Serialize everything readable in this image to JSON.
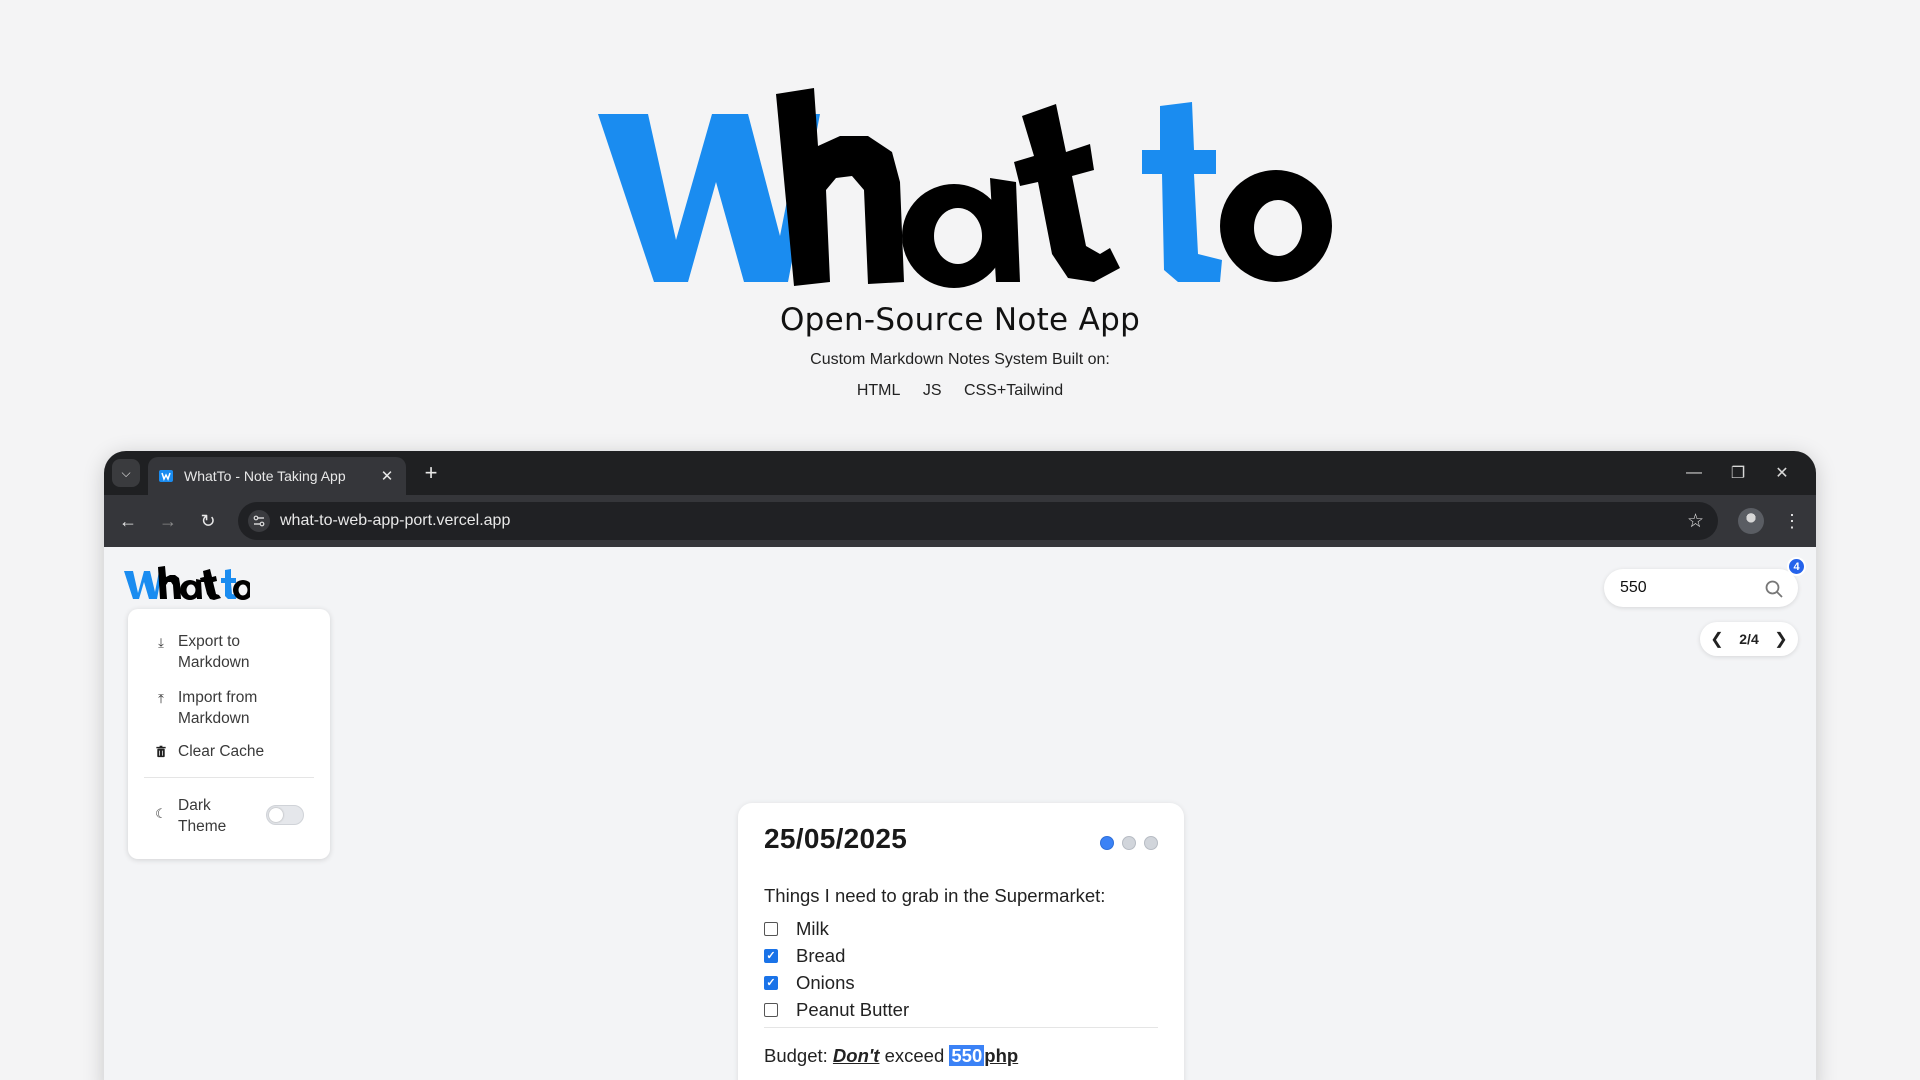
{
  "hero": {
    "logo_text": "What to",
    "subtitle": "Open-Source Note App",
    "description": "Custom Markdown Notes System Built on:",
    "tech": [
      "HTML",
      "JS",
      "CSS+Tailwind"
    ]
  },
  "browser": {
    "tab_title": "WhatTo - Note Taking App",
    "url": "what-to-web-app-port.vercel.app"
  },
  "sidebar_menu": {
    "export_label": "Export to Markdown",
    "import_label": "Import from Markdown",
    "clear_label": "Clear Cache",
    "dark_theme_label": "Dark Theme",
    "dark_theme_on": false
  },
  "search": {
    "value": "550",
    "match_count": "4",
    "pager": "2/4"
  },
  "note": {
    "date": "25/05/2025",
    "heading": "Things I need to grab in the Supermarket:",
    "items": [
      {
        "label": "Milk",
        "checked": false
      },
      {
        "label": "Bread",
        "checked": true
      },
      {
        "label": "Onions",
        "checked": true
      },
      {
        "label": "Peanut Butter",
        "checked": false
      }
    ],
    "budget_prefix": "Budget:",
    "budget_dont": "Don't",
    "budget_mid": "exceed",
    "budget_amount": "550",
    "budget_unit": "php"
  },
  "colors": {
    "brand_blue": "#1a8cf0",
    "accent_blue": "#3b82f6",
    "browser_dark": "#1f2022"
  }
}
